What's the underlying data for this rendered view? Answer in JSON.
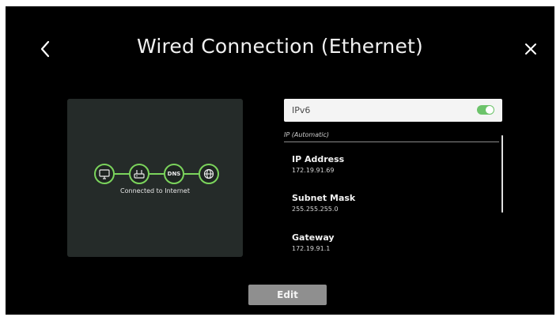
{
  "header": {
    "title": "Wired Connection (Ethernet)",
    "back_icon": "chevron-left-icon",
    "close_icon": "close-icon"
  },
  "status": {
    "nodes": [
      {
        "icon": "tv-icon"
      },
      {
        "icon": "router-icon"
      },
      {
        "label": "DNS"
      },
      {
        "icon": "globe-icon"
      }
    ],
    "label": "Connected to Internet",
    "accent_color": "#7bd45c"
  },
  "ipv6": {
    "label": "IPv6",
    "enabled": true,
    "toggle_color": "#6cc36a"
  },
  "ip_settings": {
    "section_label": "IP (Automatic)",
    "items": [
      {
        "title": "IP Address",
        "value": "172.19.91.69"
      },
      {
        "title": "Subnet Mask",
        "value": "255.255.255.0"
      },
      {
        "title": "Gateway",
        "value": "172.19.91.1"
      }
    ]
  },
  "footer": {
    "edit_label": "Edit"
  }
}
